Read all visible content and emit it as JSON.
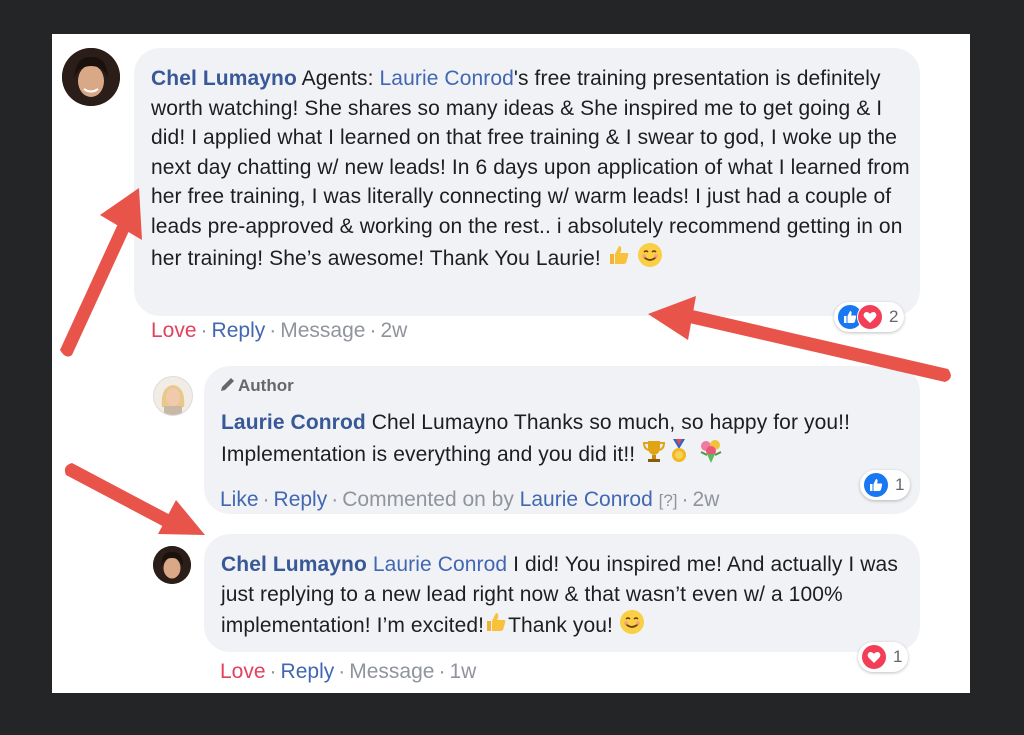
{
  "comment1": {
    "author": "Chel Lumayno",
    "text_before_mention": " Agents: ",
    "mention": "Laurie Conrod",
    "text_after": "'s free training presentation is definitely worth watching! She shares so many ideas & She inspired me to get going & I did! I applied what I learned on that free training & I swear to god, I woke up the next day chatting w/ new leads! In 6 days upon application of what I learned from her free training, I was literally connecting w/ warm leads! I just had a couple of leads pre-approved & working on the rest.. i absolutely recommend getting in on her training! She’s awesome! Thank You Laurie! ",
    "emojis": [
      "thumbs-up-emoji",
      "smiling-face-emoji"
    ],
    "actions": {
      "reaction": "Love",
      "reply": "Reply",
      "message": "Message",
      "time": "2w"
    },
    "reactions": {
      "count": "2",
      "types": [
        "like",
        "love"
      ]
    }
  },
  "comment2": {
    "badge": "Author",
    "author": "Laurie Conrod",
    "mention": "Chel Lumayno",
    "text": " Thanks so much, so happy for you!! Implementation is everything and you did it!! ",
    "emojis": [
      "trophy-emoji",
      "medal-emoji",
      "bouquet-emoji"
    ],
    "actions": {
      "reaction": "Like",
      "reply": "Reply",
      "commented_on_by": "Commented on by",
      "commenter": "Laurie Conrod",
      "help": "[?]",
      "time": "2w"
    },
    "reactions": {
      "count": "1",
      "types": [
        "like"
      ]
    }
  },
  "comment3": {
    "author": "Chel Lumayno",
    "mention": "Laurie Conrod",
    "text_a": " I did! You inspired me! And actually I was just replying to a new lead right now & that wasn’t even w/ a 100% implementation! I’m excited!",
    "text_b": "Thank you! ",
    "emojis": [
      "thumbs-up-emoji",
      "smiling-face-emoji"
    ],
    "actions": {
      "reaction": "Love",
      "reply": "Reply",
      "message": "Message",
      "time": "1w"
    },
    "reactions": {
      "count": "1",
      "types": [
        "love"
      ]
    }
  },
  "colors": {
    "link": "#4267b2",
    "name": "#385898",
    "love": "#e4405f",
    "arrow": "#e8534a",
    "bubble": "#f0f2f5"
  }
}
